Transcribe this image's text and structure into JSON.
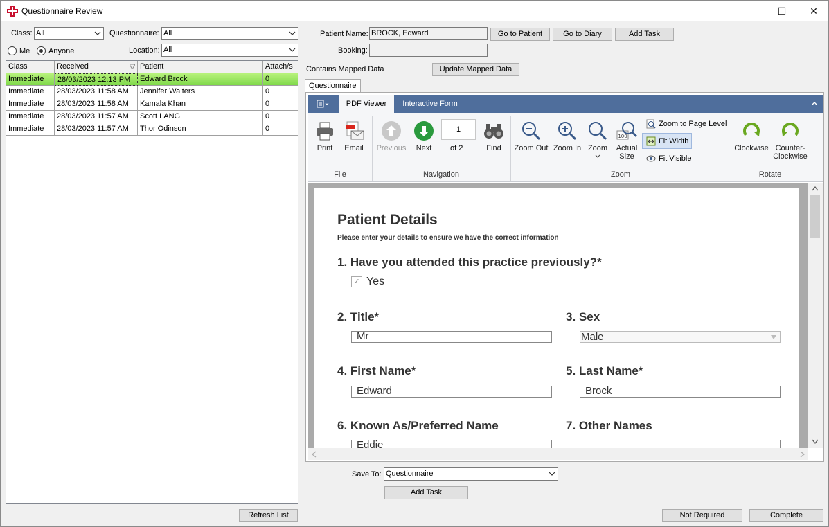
{
  "window": {
    "title": "Questionnaire Review",
    "controls": {
      "minimize": "–",
      "maximize": "☐",
      "close": "✕"
    }
  },
  "filters": {
    "class_label": "Class:",
    "class_value": "All",
    "questionnaire_label": "Questionnaire:",
    "questionnaire_value": "All",
    "me_label": "Me",
    "anyone_label": "Anyone",
    "location_label": "Location:",
    "location_value": "All"
  },
  "grid": {
    "columns": [
      "Class",
      "Received",
      "Patient",
      "Attach/s"
    ],
    "rows": [
      {
        "class": "Immediate",
        "received": "28/03/2023 12:13 PM",
        "patient": "Edward Brock",
        "attach": "0"
      },
      {
        "class": "Immediate",
        "received": "28/03/2023 11:58 AM",
        "patient": "Jennifer Walters",
        "attach": "0"
      },
      {
        "class": "Immediate",
        "received": "28/03/2023 11:58 AM",
        "patient": "Kamala Khan",
        "attach": "0"
      },
      {
        "class": "Immediate",
        "received": "28/03/2023 11:57 AM",
        "patient": "Scott LANG",
        "attach": "0"
      },
      {
        "class": "Immediate",
        "received": "28/03/2023 11:57 AM",
        "patient": "Thor Odinson",
        "attach": "0"
      }
    ],
    "refresh_label": "Refresh List"
  },
  "patient": {
    "name_label": "Patient Name:",
    "name_value": "BROCK, Edward",
    "go_patient": "Go to Patient",
    "go_diary": "Go to Diary",
    "add_task": "Add Task",
    "booking_label": "Booking:",
    "booking_value": "",
    "mapped_label": "Contains Mapped Data",
    "update_mapped": "Update Mapped Data"
  },
  "tabs": {
    "questionnaire": "Questionnaire"
  },
  "ribbon": {
    "tabs": [
      "PDF Viewer",
      "Interactive Form"
    ],
    "file": {
      "print": "Print",
      "email": "Email",
      "group": "File"
    },
    "navigation": {
      "previous": "Previous",
      "next": "Next",
      "page": "1",
      "of": "of 2",
      "find": "Find",
      "group": "Navigation"
    },
    "zoom": {
      "zoom_out": "Zoom Out",
      "zoom_in": "Zoom In",
      "zoom": "Zoom",
      "actual_size_1": "Actual",
      "actual_size_2": "Size",
      "zoom_page_level": "Zoom to Page Level",
      "fit_width": "Fit Width",
      "fit_visible": "Fit Visible",
      "group": "Zoom"
    },
    "rotate": {
      "clockwise": "Clockwise",
      "ccw_1": "Counter-",
      "ccw_2": "Clockwise",
      "group": "Rotate"
    }
  },
  "pdf": {
    "title": "Patient Details",
    "subtitle": "Please enter your details to ensure we have the correct information",
    "q1": "1. Have you attended this practice previously?*",
    "q1_answer": "Yes",
    "q2": "2. Title*",
    "q2_value": "Mr",
    "q3": "3. Sex",
    "q3_value": "Male",
    "q4": "4. First Name*",
    "q4_value": "Edward",
    "q5": "5. Last Name*",
    "q5_value": "Brock",
    "q6": "6. Known As/Preferred Name",
    "q6_value": "Eddie",
    "q7": "7. Other Names",
    "q7_value": ""
  },
  "footer": {
    "save_to_label": "Save To:",
    "save_to_value": "Questionnaire",
    "add_task": "Add Task",
    "not_required": "Not Required",
    "complete": "Complete"
  },
  "colors": {
    "ribbon_tab_bar": "#4f6e9c",
    "selected_row": "#8ee35a",
    "brand_red": "#c8102e"
  }
}
